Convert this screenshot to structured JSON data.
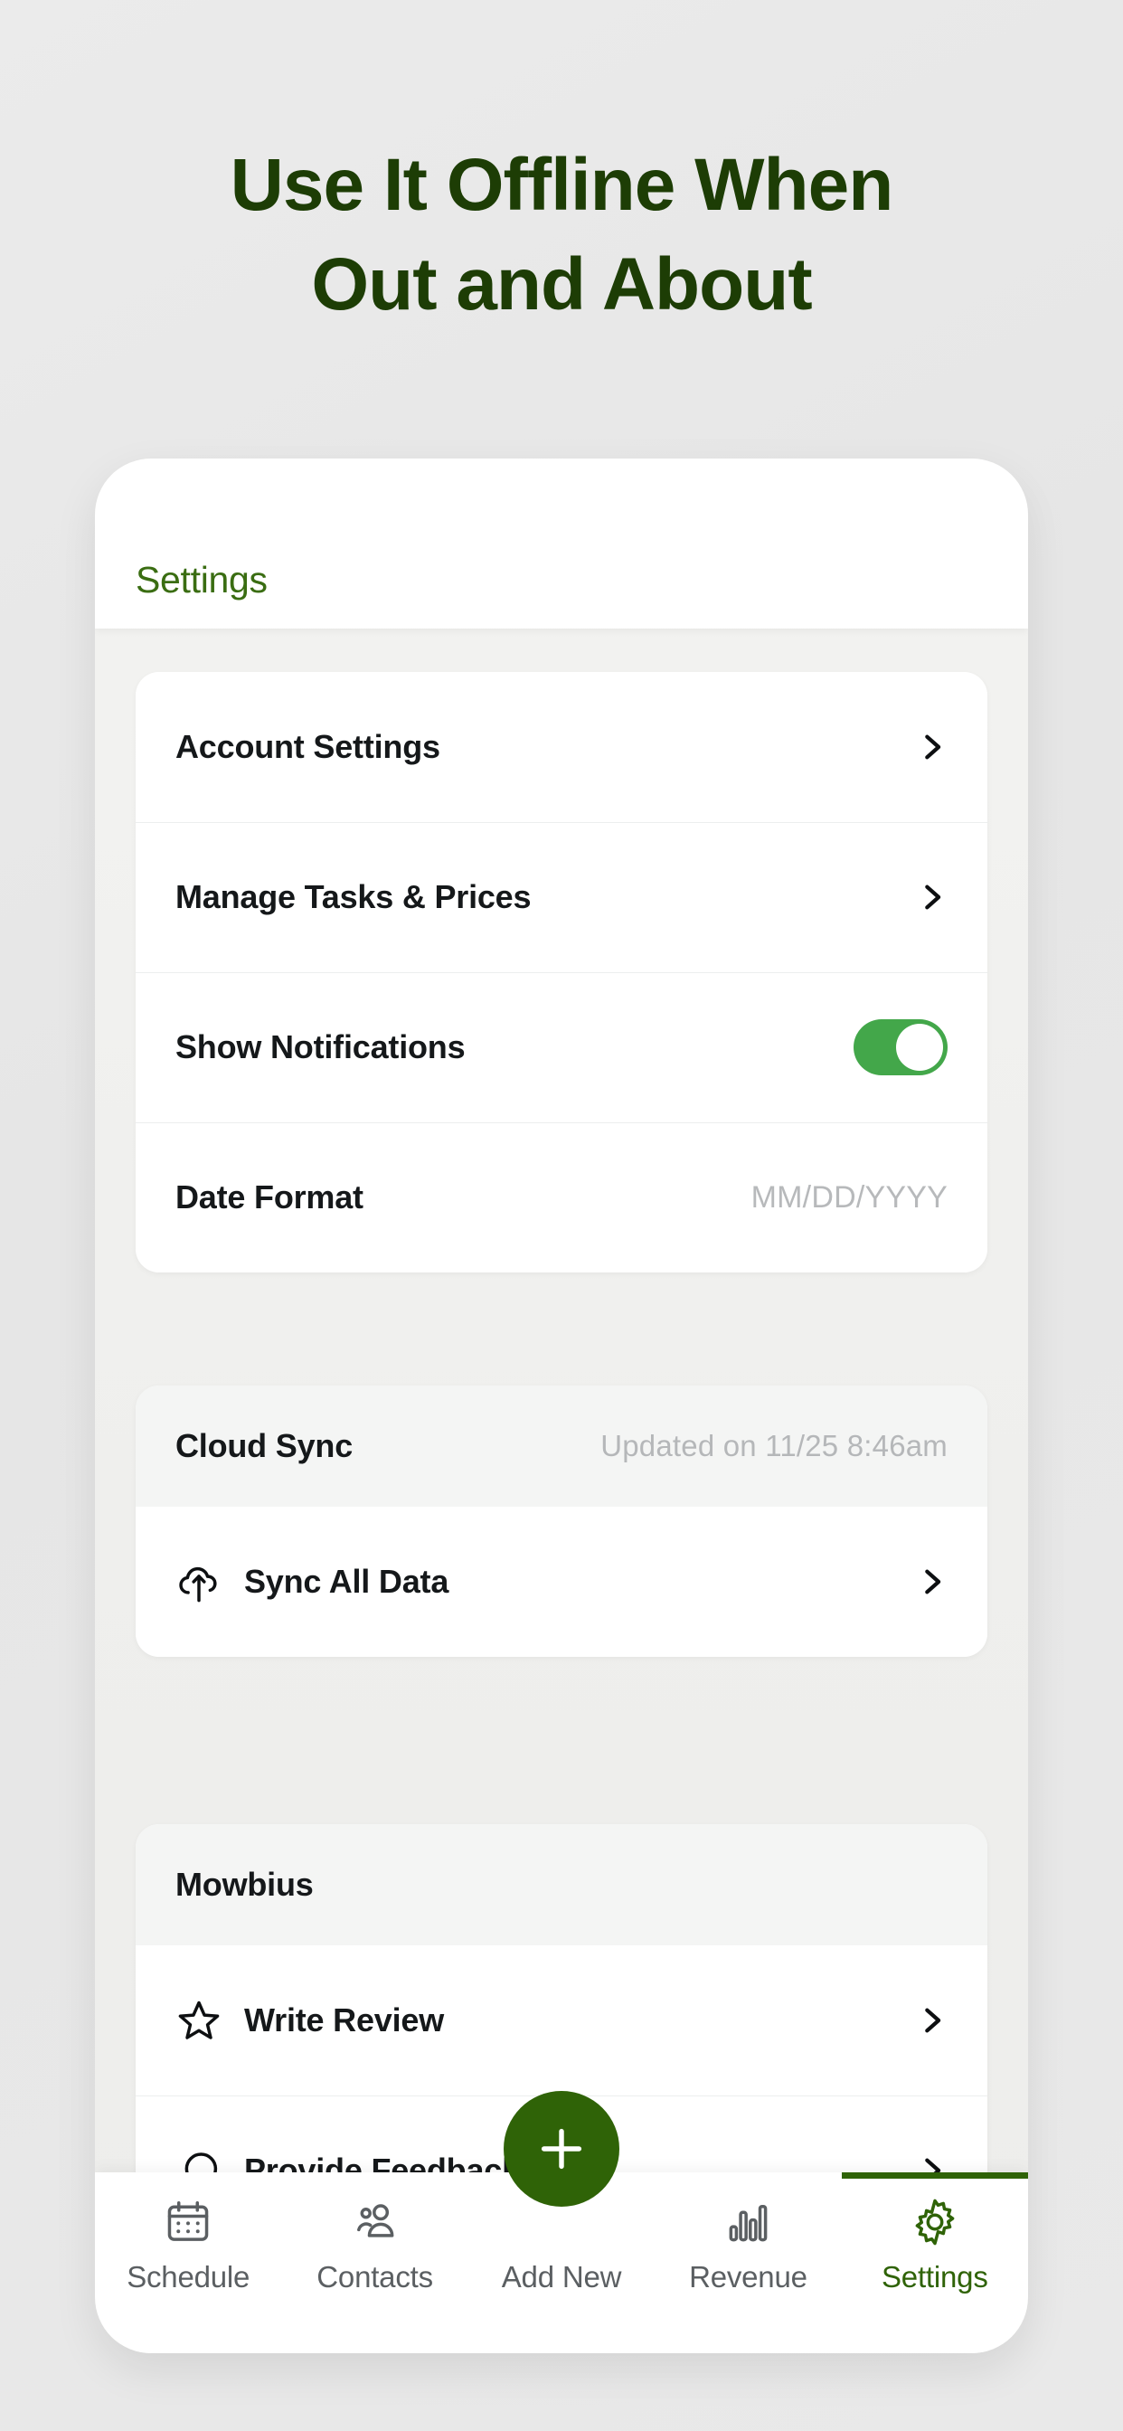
{
  "headline": {
    "line1": "Use It Offline When",
    "line2": "Out and About"
  },
  "colors": {
    "headline": "#1d3d05",
    "accent": "#2f6307",
    "appbar_title": "#3a6d12",
    "toggle_on": "#43a74a",
    "page_background": "#e8e8e8"
  },
  "appbar": {
    "title": "Settings"
  },
  "settings_group": {
    "rows": [
      {
        "label": "Account Settings",
        "type": "chevron"
      },
      {
        "label": "Manage Tasks & Prices",
        "type": "chevron"
      },
      {
        "label": "Show Notifications",
        "type": "toggle",
        "value": "on"
      },
      {
        "label": "Date Format",
        "type": "value",
        "value": "MM/DD/YYYY"
      }
    ]
  },
  "cloud_sync_group": {
    "header": {
      "label": "Cloud Sync",
      "value": "Updated on 11/25 8:46am"
    },
    "rows": [
      {
        "label": "Sync All Data",
        "icon": "cloud-upload-icon",
        "type": "chevron"
      }
    ]
  },
  "mowbius_group": {
    "header": {
      "label": "Mowbius",
      "value": ""
    },
    "rows": [
      {
        "label": "Write Review",
        "icon": "star-icon",
        "type": "chevron"
      },
      {
        "label": "Provide Feedback",
        "icon": "chat-bubble-icon",
        "type": "chevron"
      }
    ]
  },
  "bottom_nav": {
    "items": [
      {
        "label": "Schedule",
        "icon": "calendar-icon",
        "active": false
      },
      {
        "label": "Contacts",
        "icon": "people-icon",
        "active": false
      },
      {
        "label": "Add New",
        "icon": "plus-icon",
        "active": false
      },
      {
        "label": "Revenue",
        "icon": "bar-chart-icon",
        "active": false
      },
      {
        "label": "Settings",
        "icon": "gear-icon",
        "active": true
      }
    ]
  },
  "fab": {
    "icon": "plus-icon"
  }
}
